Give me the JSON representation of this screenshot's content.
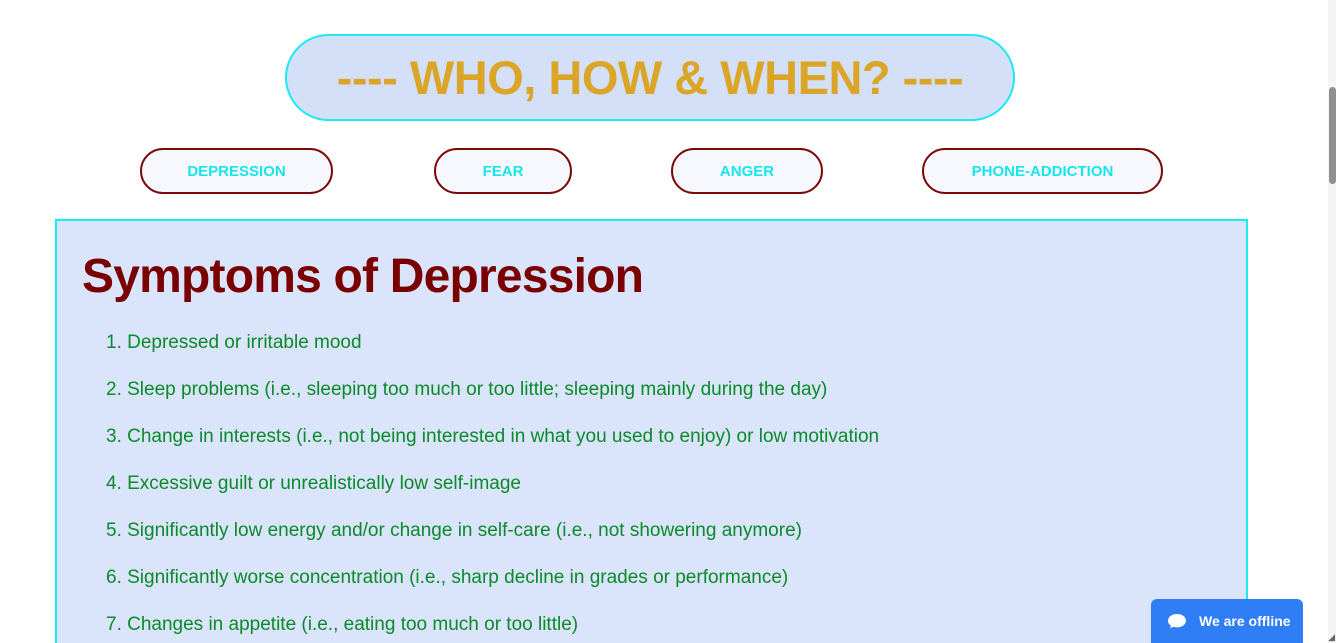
{
  "banner": {
    "title": "---- WHO, HOW & WHEN? ----"
  },
  "tabs": [
    {
      "label": "DEPRESSION"
    },
    {
      "label": "FEAR"
    },
    {
      "label": "ANGER"
    },
    {
      "label": "PHONE-ADDICTION"
    }
  ],
  "content": {
    "title": "Symptoms of Depression",
    "symptoms": [
      "1. Depressed or irritable mood",
      "2. Sleep problems (i.e., sleeping too much or too little; sleeping mainly during the day)",
      "3. Change in interests (i.e., not being interested in what you used to enjoy) or low motivation",
      "4. Excessive guilt or unrealistically low self-image",
      "5. Significantly low energy and/or change in self-care (i.e., not showering anymore)",
      "6. Significantly worse concentration (i.e., sharp decline in grades or performance)",
      "7. Changes in appetite (i.e., eating too much or too little)"
    ]
  },
  "chat": {
    "status_label": "We are offline",
    "icon": "chat-bubble-icon"
  },
  "colors": {
    "banner_text": "#dba628",
    "accent_cyan": "#1de9f0",
    "title_maroon": "#7a0000",
    "list_green": "#0a8a2a",
    "chat_blue": "#2f7ef6"
  }
}
